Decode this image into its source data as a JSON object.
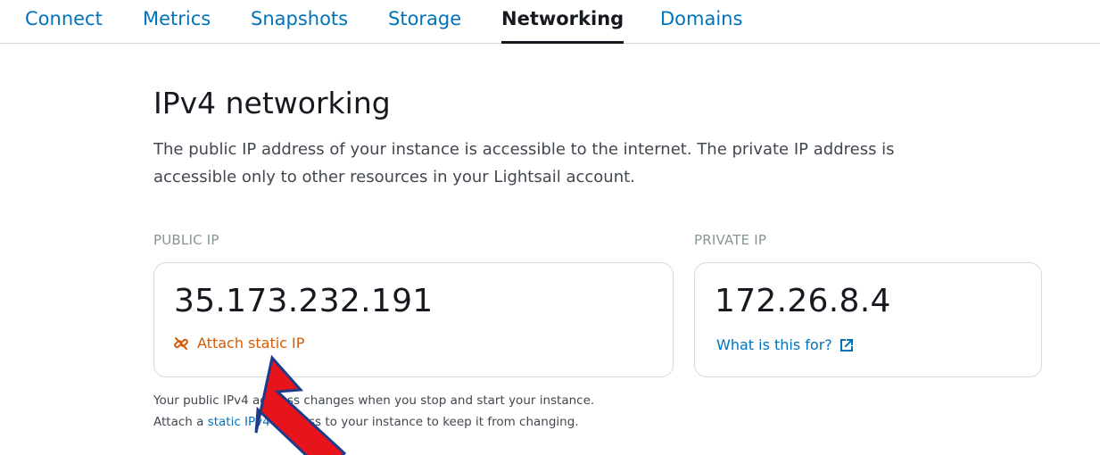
{
  "tabs": [
    {
      "label": "Connect"
    },
    {
      "label": "Metrics"
    },
    {
      "label": "Snapshots"
    },
    {
      "label": "Storage"
    },
    {
      "label": "Networking",
      "active": true
    },
    {
      "label": "Domains"
    }
  ],
  "section": {
    "title": "IPv4 networking",
    "description": "The public IP address of your instance is accessible to the internet. The private IP address is accessible only to other resources in your Lightsail account."
  },
  "public_ip": {
    "label": "PUBLIC IP",
    "value": "35.173.232.191",
    "action_label": "Attach static IP",
    "action_icon": "link-icon"
  },
  "private_ip": {
    "label": "PRIVATE IP",
    "value": "172.26.8.4",
    "help_link": "What is this for?",
    "help_icon": "external-link-icon"
  },
  "note": {
    "line1": "Your public IPv4 address changes when you stop and start your instance.",
    "line2_prefix": "Attach a ",
    "line2_link": "static IPv4",
    "line2_suffix": " address to your instance to keep it from changing."
  },
  "colors": {
    "link": "#0073bb",
    "action": "#d45b07",
    "annotation_arrow": "#e8141b",
    "annotation_outline": "#1e3a8a"
  }
}
